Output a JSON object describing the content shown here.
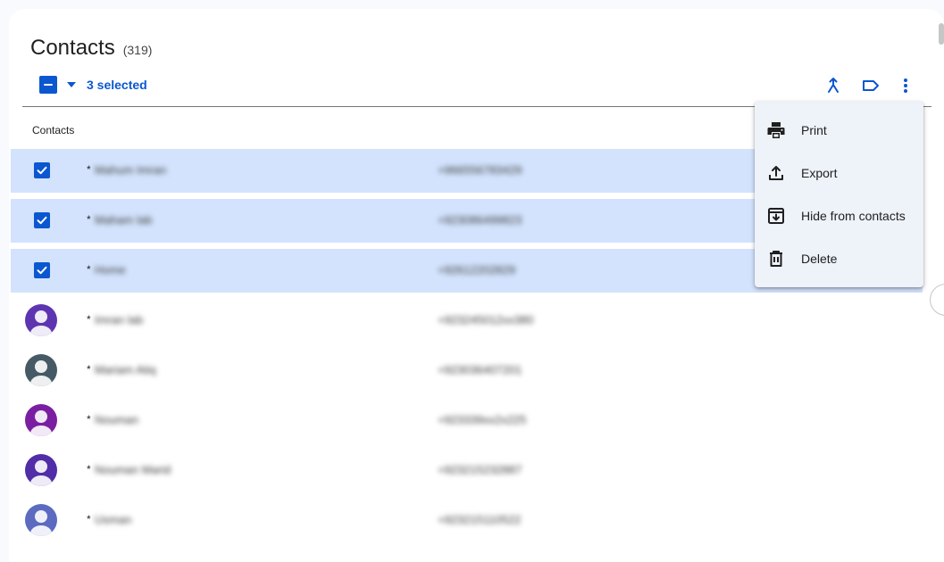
{
  "header": {
    "title": "Contacts",
    "count": "(319)"
  },
  "selection": {
    "text": "3 selected"
  },
  "list": {
    "column_header": "Contacts"
  },
  "contacts": [
    {
      "star": "*",
      "name": "Mahum Imran",
      "phone": "+966556783429",
      "selected": true,
      "avatar_color": "#3b5bdb"
    },
    {
      "star": "*",
      "name": "Maham lab",
      "phone": "+923086499823",
      "selected": true,
      "avatar_color": "#3b5bdb"
    },
    {
      "star": "*",
      "name": "Home",
      "phone": "+92612202829",
      "selected": true,
      "avatar_color": "#3b5bdb"
    },
    {
      "star": "*",
      "name": "Imran lab",
      "phone": "+923245012xx380",
      "selected": false,
      "avatar_color": "#5e35b1"
    },
    {
      "star": "*",
      "name": "Mariam Atiq",
      "phone": "+923036407201",
      "selected": false,
      "avatar_color": "#455a64"
    },
    {
      "star": "*",
      "name": "Nouman",
      "phone": "+923339xx2x225",
      "selected": false,
      "avatar_color": "#7b1fa2"
    },
    {
      "star": "*",
      "name": "Nouman Marid",
      "phone": "+923215232887",
      "selected": false,
      "avatar_color": "#512da8"
    },
    {
      "star": "*",
      "name": "Usman",
      "phone": "+923215110522",
      "selected": false,
      "avatar_color": "#5c6bc0"
    }
  ],
  "menu": {
    "items": [
      {
        "label": "Print",
        "icon": "print-icon"
      },
      {
        "label": "Export",
        "icon": "export-icon"
      },
      {
        "label": "Hide from contacts",
        "icon": "hide-icon"
      },
      {
        "label": "Delete",
        "icon": "delete-icon"
      }
    ]
  },
  "colors": {
    "accent": "#0b57d0",
    "selected_row": "#d3e3fd",
    "menu_bg": "#eef2f9"
  }
}
